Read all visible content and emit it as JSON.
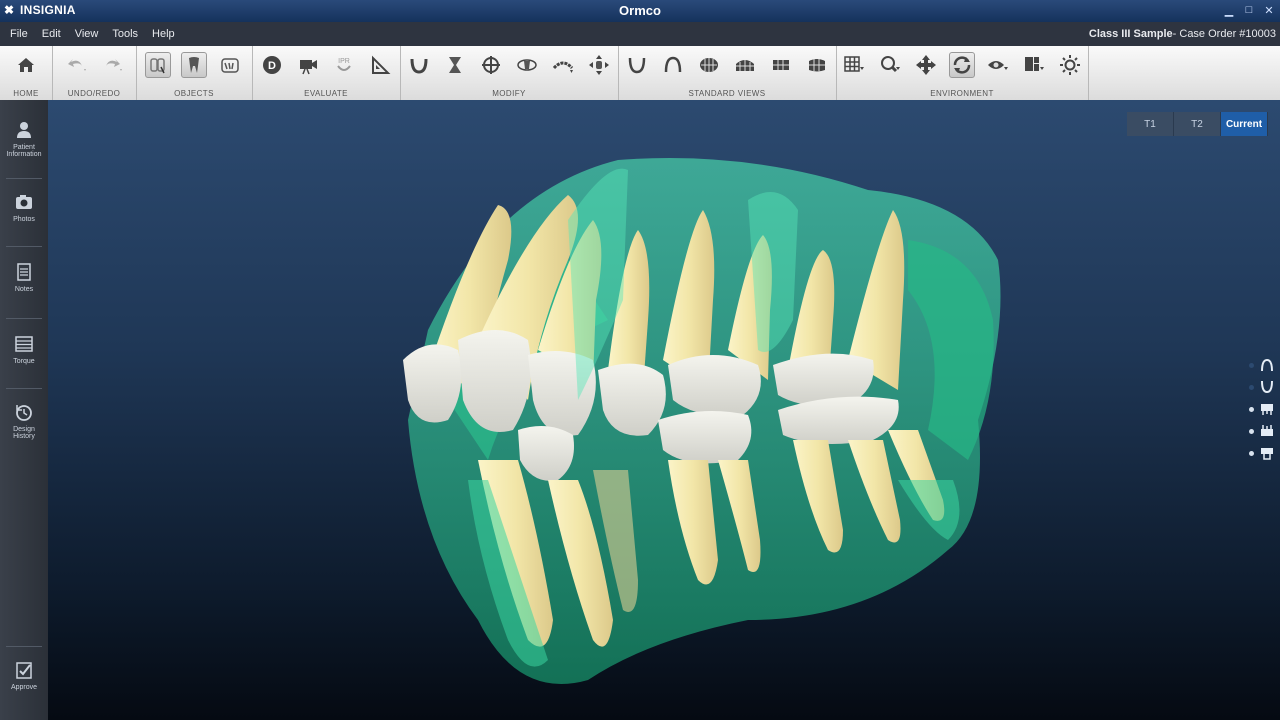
{
  "titlebar": {
    "brand": "INSIGNIA",
    "title": "Ormco"
  },
  "menu": {
    "items": [
      "File",
      "Edit",
      "View",
      "Tools",
      "Help"
    ]
  },
  "case": {
    "name": "Class III Sample",
    "order": "- Case Order #10003"
  },
  "toolbar": {
    "groups": [
      {
        "label": "HOME"
      },
      {
        "label": "UNDO/REDO"
      },
      {
        "label": "OBJECTS"
      },
      {
        "label": "EVALUATE"
      },
      {
        "label": "MODIFY"
      },
      {
        "label": "STANDARD VIEWS"
      },
      {
        "label": "ENVIRONMENT"
      }
    ],
    "ipr_text": "IPR",
    "d_text": "D"
  },
  "sidebar": {
    "items": [
      {
        "label": "Patient Information",
        "icon": "person-icon"
      },
      {
        "label": "Photos",
        "icon": "camera-icon"
      },
      {
        "label": "Notes",
        "icon": "notes-icon"
      },
      {
        "label": "Torque",
        "icon": "table-icon"
      },
      {
        "label": "Design History",
        "icon": "history-icon"
      },
      {
        "label": "Approve",
        "icon": "approve-icon"
      }
    ]
  },
  "viewport": {
    "timepoints": [
      {
        "label": "T1",
        "active": false
      },
      {
        "label": "T2",
        "active": false
      },
      {
        "label": "Current",
        "active": true
      }
    ]
  },
  "colors": {
    "tooth_enamel": "#f2e9b4",
    "gingiva_green": "#3ad6a0",
    "crown_white": "#e6e6e0",
    "accent": "#1f5ea8"
  }
}
